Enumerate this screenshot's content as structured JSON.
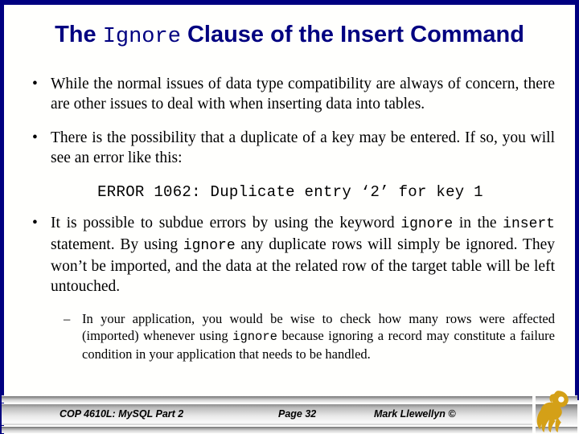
{
  "theme": {
    "frame_color": "#000080",
    "title_color": "#000080",
    "body_color": "#000000",
    "background": "#FFFFFD",
    "logo_color": "#D4A017"
  },
  "title": {
    "pre": "The ",
    "mono": "Ignore",
    "post": " Clause of the Insert Command",
    "full": "The Ignore Clause of the Insert Command"
  },
  "body": {
    "bullet_marker": "•",
    "dash_marker": "–",
    "bullets": [
      {
        "id": "bullet-1",
        "text": "While the normal issues of data type compatibility are always of concern, there are other issues to deal with when inserting data into tables."
      },
      {
        "id": "bullet-2",
        "text": "There is the possibility that a duplicate of a key may be entered.  If so, you will see an error like this:"
      }
    ],
    "code_line": "ERROR 1062: Duplicate entry ‘2’ for key 1",
    "bullet_3": {
      "id": "bullet-3",
      "seg_1": "It is possible to subdue errors by using the keyword ",
      "mono_1": "ignore",
      "seg_2": " in the ",
      "mono_2": "insert",
      "seg_3": " statement.  By using ",
      "mono_3": "ignore",
      "seg_4": " any duplicate rows will simply be ignored.  They won’t be imported, and the data at the related row of the target table will be left untouched."
    },
    "sub_bullet": {
      "id": "sub-bullet-1",
      "seg_1": "In your application, you would be wise to check how many rows were affected (imported) whenever using ",
      "mono_1": "ignore",
      "seg_2": " because ignoring a record may constitute a failure condition in your application that needs to be handled."
    }
  },
  "footer": {
    "course": "COP 4610L: MySQL Part 2",
    "page": "Page 32",
    "author": "Mark Llewellyn ©",
    "logo_name": "ucf-pegasus-logo"
  }
}
